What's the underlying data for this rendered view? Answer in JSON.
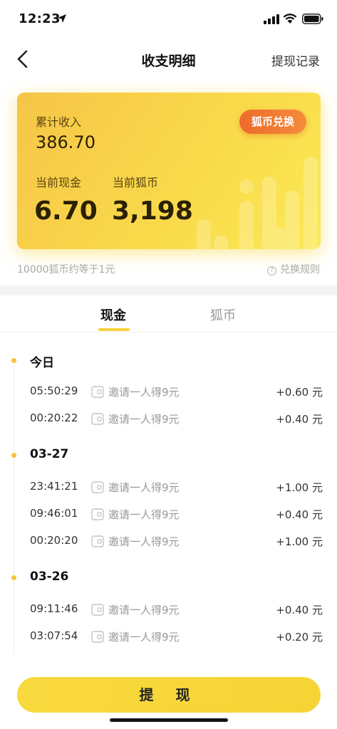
{
  "status_bar": {
    "time": "12:23"
  },
  "nav": {
    "title": "收支明细",
    "right_link": "提现记录"
  },
  "summary_card": {
    "total_income_label": "累计收入",
    "total_income_value": "386.70",
    "current_cash_label": "当前现金",
    "current_cash_value": "6.70",
    "current_coin_label": "当前狐币",
    "current_coin_value": "3,198",
    "exchange_button": "狐币兑换"
  },
  "rate_note": "10000狐币约等于1元",
  "rules_link": "兑换规则",
  "tabs": [
    {
      "label": "现金",
      "active": true
    },
    {
      "label": "狐币",
      "active": false
    }
  ],
  "groups": [
    {
      "date": "今日",
      "items": [
        {
          "time": "05:50:29",
          "desc": "邀请一人得9元",
          "amount": "+0.60 元"
        },
        {
          "time": "00:20:22",
          "desc": "邀请一人得9元",
          "amount": "+0.40 元"
        }
      ]
    },
    {
      "date": "03-27",
      "items": [
        {
          "time": "23:41:21",
          "desc": "邀请一人得9元",
          "amount": "+1.00 元"
        },
        {
          "time": "09:46:01",
          "desc": "邀请一人得9元",
          "amount": "+0.40 元"
        },
        {
          "time": "00:20:20",
          "desc": "邀请一人得9元",
          "amount": "+1.00 元"
        }
      ]
    },
    {
      "date": "03-26",
      "items": [
        {
          "time": "09:11:46",
          "desc": "邀请一人得9元",
          "amount": "+0.40 元"
        },
        {
          "time": "03:07:54",
          "desc": "邀请一人得9元",
          "amount": "+0.20 元"
        }
      ]
    }
  ],
  "withdraw_button": "提 现",
  "colors": {
    "accent_yellow": "#f7d23d",
    "exchange_orange": "#ee6a2c"
  }
}
